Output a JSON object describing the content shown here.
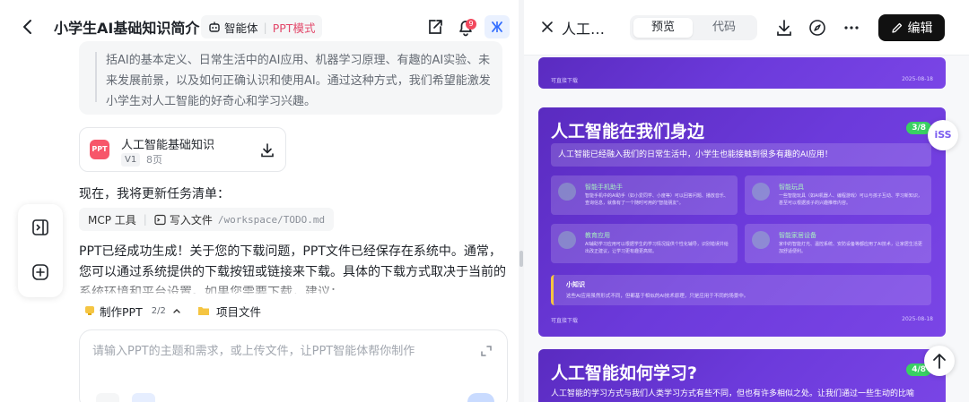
{
  "header": {
    "title": "小学生AI基础知识简介",
    "agent_label": "智能体",
    "mode_label": "PPT模式",
    "notification_count": "9"
  },
  "quote": {
    "text": "括AI的基本定义、日常生活中的AI应用、机器学习原理、有趣的AI实验、未来发展前景，以及如何正确认识和使用AI。通过这种方式，我们希望能激发小学生对人工智能的好奇心和学习兴趣。"
  },
  "file_card": {
    "icon_text": "PPT",
    "name": "人工智能基础知识",
    "version": "V1",
    "pages": "8页"
  },
  "task_line": "现在，我将更新任务清单：",
  "tool_call": {
    "tool": "MCP 工具",
    "action": "写入文件",
    "path": "/workspace/TODO.md"
  },
  "message": "PPT已经成功生成！关于您的下载问题，PPT文件已经保存在系统中。通常，您可以通过系统提供的下载按钮或链接来下载。具体的下载方式取决于当前的系统环境和平台设置。如果您需要下载，建议：",
  "chips": {
    "make_ppt": "制作PPT",
    "make_ppt_count": "2/2",
    "project_files": "项目文件"
  },
  "input": {
    "placeholder": "请输入PPT的主题和需求，或上传文件，让PPT智能体帮你制作"
  },
  "preview": {
    "title": "人工智...",
    "tab_preview": "预览",
    "tab_code": "代码",
    "edit_label": "编辑"
  },
  "slides": [
    {
      "footer": "可直接下载",
      "date": "2025-08-18"
    },
    {
      "title": "人工智能在我们身边",
      "page": "3/8",
      "intro": "人工智能已经融入我们的日常生活中，小学生也能接触到很多有趣的AI应用！",
      "cards": [
        {
          "title": "智能手机助手",
          "desc": "智能手机中的AI助手（如小爱同学、小度等）可以回答问题、播放音乐、查询信息，就像有了一个随时可用的\"智能朋友\"。"
        },
        {
          "title": "智能玩具",
          "desc": "一些智能玩具（如AI机器人、编程游戏）可以与孩子互动、学习新知识，甚至可以根据孩子的兴趣推荐内容。"
        },
        {
          "title": "教育应用",
          "desc": "AI辅助学习应用可以根据学生的学习情况提供个性化辅导，识别错误并给出改正建议，让学习更有趣更高效。"
        },
        {
          "title": "智能家居设备",
          "desc": "家中的智能灯光、温控系统、安防设备等都应用了AI技术，让家居生活更加舒适便利。"
        }
      ],
      "tip_title": "小知识",
      "tip_text": "这些AI应用虽然形式不同，但都基于相似的AI技术原理，只是应用于不同的场景中。",
      "footer": "可直接下载",
      "date": "2025-08-18"
    },
    {
      "title": "人工智能如何学习?",
      "page": "4/8",
      "intro": "人工智能的学习方式与我们人类学习方式有些不同，但也有许多相似之处。让我们通过一些生动的比喻"
    }
  ],
  "float_logo": "iSS",
  "colors": {
    "accent_pink": "#e2486a",
    "badge_red": "#f2495e",
    "slide_purple": "#6c3adb",
    "page_green": "#39d063"
  }
}
